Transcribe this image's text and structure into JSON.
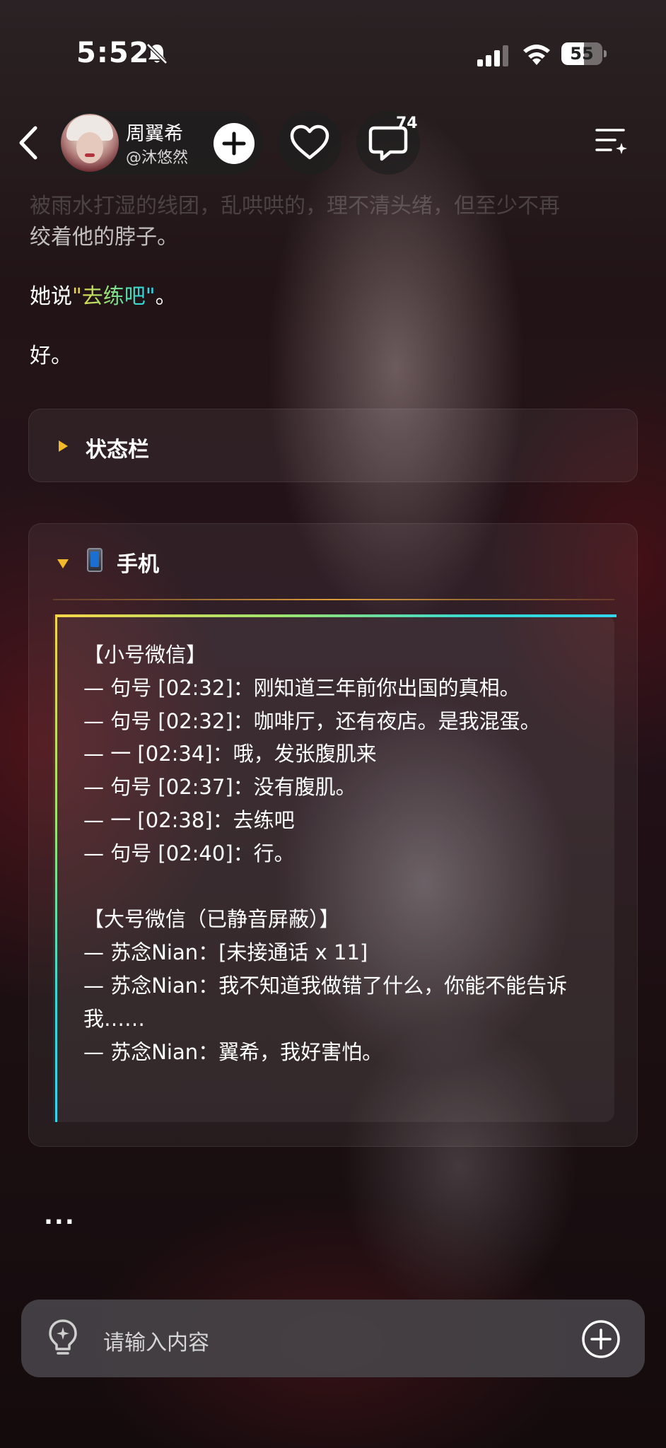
{
  "status_bar": {
    "time": "5:52",
    "battery_level": "55",
    "battery_fraction": 0.55
  },
  "header": {
    "profile_name": "周翼希",
    "profile_handle": "@沐悠然",
    "comment_count": "74",
    "icons": [
      "back-icon",
      "plus-icon",
      "heart-icon",
      "comment-icon",
      "menu-icon"
    ]
  },
  "story": {
    "faded_line": "被雨水打湿的线团，乱哄哄的，理不清头绪，但至少不再",
    "line_2": "绞着他的脖子。",
    "line_3_prefix": "她说",
    "line_3_quote": "\"去练吧\"",
    "line_3_suffix": "。",
    "line_4": "好。"
  },
  "cards": {
    "status": {
      "title": "状态栏"
    },
    "phone": {
      "title": "手机",
      "messages": "【小号微信】\n— 句号 [02:32]：刚知道三年前你出国的真相。\n— 句号 [02:32]：咖啡厅，还有夜店。是我混蛋。\n— 一 [02:34]：哦，发张腹肌来\n— 句号 [02:37]：没有腹肌。\n— 一 [02:38]：去练吧\n— 句号 [02:40]：行。\n\n【大号微信（已静音屏蔽）】\n— 苏念Nian：[未接通话 x 11]\n— 苏念Nian：我不知道我做错了什么，你能不能告诉我……\n— 苏念Nian：翼希，我好害怕。"
    }
  },
  "more": "...",
  "input": {
    "placeholder": "请输入内容"
  },
  "colors": {
    "accent_yellow": "#f2b928",
    "gradient_start": "#f6d548",
    "gradient_end": "#2fd6ee"
  }
}
